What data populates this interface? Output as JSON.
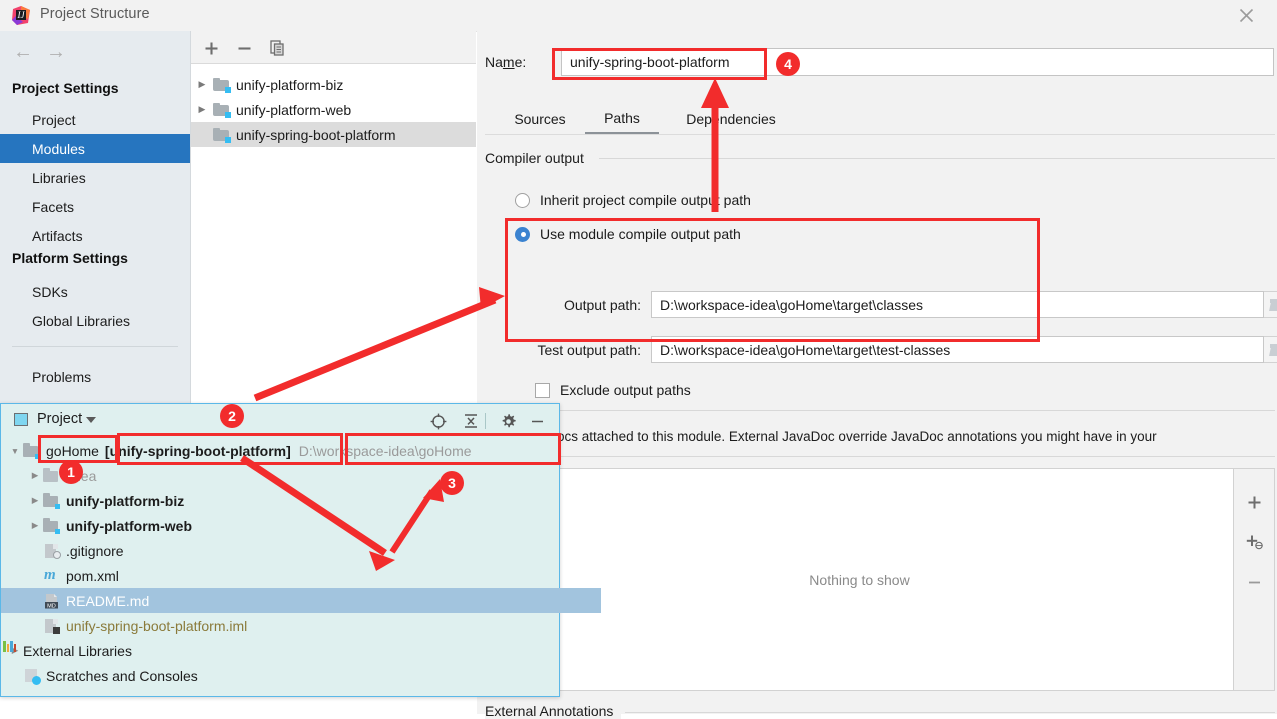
{
  "window": {
    "title": "Project Structure",
    "app_icon": "intellij-idea-icon",
    "close_icon": "close-icon"
  },
  "sidebar": {
    "back_icon": "arrow-left-icon",
    "forward_icon": "arrow-right-icon",
    "groups": [
      {
        "label": "Project Settings",
        "items": [
          "Project",
          "Modules",
          "Libraries",
          "Facets",
          "Artifacts"
        ]
      },
      {
        "label": "Platform Settings",
        "items": [
          "SDKs",
          "Global Libraries"
        ]
      }
    ],
    "selected": "Modules",
    "footer_item": "Problems"
  },
  "modules_panel": {
    "toolbar": [
      {
        "name": "add-module-button",
        "glyph": "+"
      },
      {
        "name": "remove-module-button",
        "glyph": "−"
      },
      {
        "name": "copy-module-button",
        "glyph": "copy-icon"
      }
    ],
    "modules": [
      {
        "name": "unify-platform-biz",
        "expandable": true,
        "selected": false
      },
      {
        "name": "unify-platform-web",
        "expandable": true,
        "selected": false
      },
      {
        "name": "unify-spring-boot-platform",
        "expandable": false,
        "selected": true
      }
    ]
  },
  "detail": {
    "name_label": "Name:",
    "name_value": "unify-spring-boot-platform",
    "tabs": [
      {
        "label": "Sources",
        "active": false
      },
      {
        "label": "Paths",
        "active": true
      },
      {
        "label": "Dependencies",
        "active": false
      }
    ],
    "compiler_output": {
      "section_title": "Compiler output",
      "inherit_option": "Inherit project compile output path",
      "module_option": "Use module compile output path",
      "selected_option": "module",
      "output_path_label": "Output path:",
      "output_path_value": "D:\\workspace-idea\\goHome\\target\\classes",
      "test_output_path_label": "Test output path:",
      "test_output_path_value": "D:\\workspace-idea\\goHome\\target\\test-classes",
      "exclude_label": "Exclude output paths",
      "exclude_checked": false,
      "browse_icon": "folder-browse-icon"
    },
    "javadoc": {
      "description": "ernal JavaDocs attached to this module. External JavaDoc override JavaDoc annotations you might have in your",
      "empty_text": "Nothing to show",
      "buttons": [
        {
          "name": "add-javadoc-button",
          "glyph": "+"
        },
        {
          "name": "add-javadoc-url-button",
          "glyph": "+ₒ"
        },
        {
          "name": "remove-javadoc-button",
          "glyph": "−"
        }
      ]
    },
    "bottom_section_title": "External Annotations"
  },
  "project_tool_window": {
    "title": "Project",
    "title_icon": "project-view-icon",
    "dropdown_icon": "chevron-down-icon",
    "toolbar": [
      {
        "name": "locate-file-icon",
        "glyph": "target-icon"
      },
      {
        "name": "collapse-all-icon",
        "glyph": "collapse-icon"
      },
      {
        "name": "settings-gear-icon",
        "glyph": "gear-icon"
      },
      {
        "name": "hide-panel-icon",
        "glyph": "minus-icon"
      }
    ],
    "tree": [
      {
        "label": "goHome",
        "suffix": "[unify-spring-boot-platform]",
        "path": "D:\\workspace-idea\\goHome",
        "icon": "folder-icon",
        "expandable": true,
        "expanded": true,
        "depth": 0,
        "style": "normal",
        "selected": false
      },
      {
        "label": ".idea",
        "icon": "folder-icon",
        "expandable": true,
        "expanded": false,
        "depth": 1,
        "style": "muted",
        "selected": false
      },
      {
        "label": "unify-platform-biz",
        "icon": "module-folder-icon",
        "expandable": true,
        "expanded": false,
        "depth": 1,
        "style": "bold",
        "selected": false
      },
      {
        "label": "unify-platform-web",
        "icon": "module-folder-icon",
        "expandable": true,
        "expanded": false,
        "depth": 1,
        "style": "bold",
        "selected": false
      },
      {
        "label": ".gitignore",
        "icon": "gitignore-file-icon",
        "expandable": false,
        "depth": 1,
        "style": "normal",
        "selected": false
      },
      {
        "label": "pom.xml",
        "icon": "maven-file-icon",
        "expandable": false,
        "depth": 1,
        "style": "normal",
        "selected": false
      },
      {
        "label": "README.md",
        "icon": "markdown-file-icon",
        "expandable": false,
        "depth": 1,
        "style": "normal",
        "selected": true
      },
      {
        "label": "unify-spring-boot-platform.iml",
        "icon": "iml-file-icon",
        "expandable": false,
        "depth": 1,
        "style": "olive",
        "selected": false
      },
      {
        "label": "External Libraries",
        "icon": "external-libraries-icon",
        "expandable": true,
        "expanded": false,
        "depth": 0,
        "style": "normal",
        "selected": false
      },
      {
        "label": "Scratches and Consoles",
        "icon": "scratches-icon",
        "expandable": false,
        "depth": 0,
        "style": "normal",
        "selected": false
      }
    ]
  },
  "annotations": {
    "accent_color": "#f22c2c",
    "badges": [
      {
        "id": "1",
        "label": "1"
      },
      {
        "id": "2",
        "label": "2"
      },
      {
        "id": "3",
        "label": "3"
      },
      {
        "id": "4",
        "label": "4"
      }
    ]
  }
}
